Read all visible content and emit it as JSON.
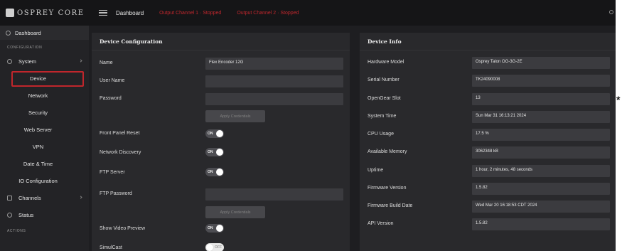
{
  "header": {
    "brand": "OSPREY CORE",
    "breadcrumb": "Dashboard",
    "alerts": [
      "Output Channel 1 · Stopped",
      "Output Channel 2 · Stopped"
    ]
  },
  "sidebar": {
    "top_item": "Dashboard",
    "configuration_heading": "CONFIGURATION",
    "system_label": "System",
    "sub_items": [
      "Device",
      "Network",
      "Security",
      "Web Server",
      "VPN",
      "Date & Time",
      "IO Configuration"
    ],
    "selected": "Device",
    "channels_label": "Channels",
    "status_label": "Status",
    "actions_heading": "ACTIONS"
  },
  "device_config": {
    "title": "Device Configuration",
    "name_label": "Name",
    "name_value": "Flex Encoder 12G",
    "username_label": "User Name",
    "password_label": "Password",
    "apply_label": "Apply Credentials",
    "front_panel_label": "Front Panel Reset",
    "network_discovery_label": "Network Discovery",
    "ftp_server_label": "FTP Server",
    "ftp_password_label": "FTP Password",
    "apply2_label": "Apply Credentials",
    "show_video_label": "Show Video Preview",
    "simulcast_label": "SimulCast",
    "toggle_on_text": "ON",
    "toggle_off_text": "OFF"
  },
  "device_info": {
    "title": "Device Info",
    "rows": [
      {
        "label": "Hardware Model",
        "value": "Osprey Talon OG-3G-2E"
      },
      {
        "label": "Serial Number",
        "value": "TK24090008"
      },
      {
        "label": "OpenGear Slot",
        "value": "13"
      },
      {
        "label": "System Time",
        "value": "Sun Mar 31 16:13:21 2024"
      },
      {
        "label": "CPU Usage",
        "value": "17.5 %"
      },
      {
        "label": "Available Memory",
        "value": "3062348 kB"
      },
      {
        "label": "Uptime",
        "value": "1 hour, 2 minutes, 48 seconds"
      },
      {
        "label": "Firmware Version",
        "value": "1.5.82"
      },
      {
        "label": "Firmware Build Date",
        "value": "Wed Mar 20 16:18:53 CDT 2024"
      },
      {
        "label": "API Version",
        "value": "1.5.82"
      }
    ]
  },
  "margin_mark": "*",
  "colors": {
    "accent_red": "#c1272d",
    "background": "#1e1e21"
  }
}
